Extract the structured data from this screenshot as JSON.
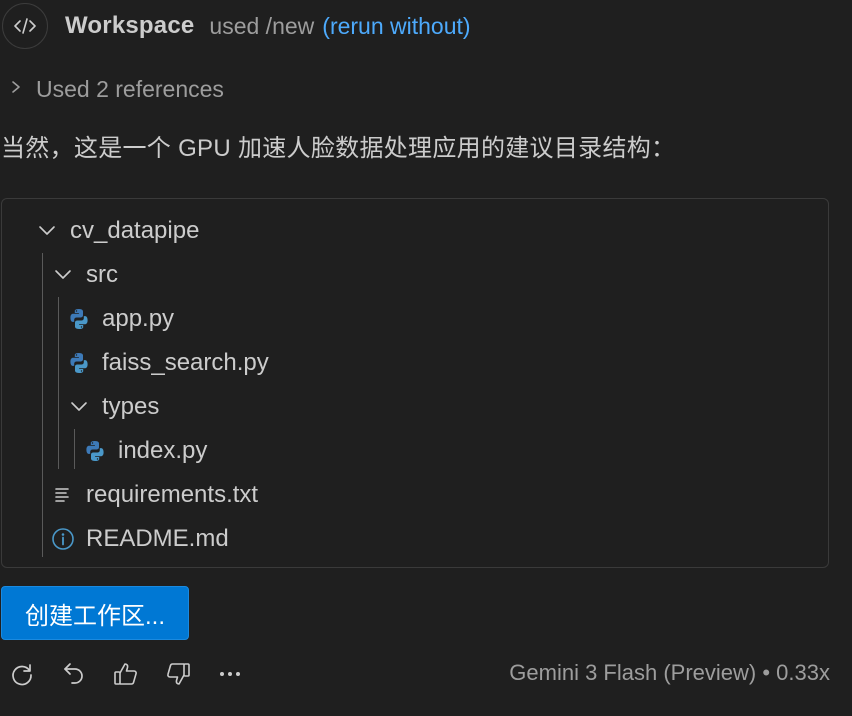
{
  "header": {
    "icon": "code-brackets-icon",
    "title": "Workspace",
    "used_text": "used /new",
    "rerun_link": "(rerun without)"
  },
  "references": {
    "label": "Used 2 references",
    "icon": "chevron-right-icon"
  },
  "intro_text": "当然，这是一个 GPU 加速人脸数据处理应用的建议目录结构：",
  "tree": {
    "items": [
      {
        "name": "cv_datapipe",
        "kind": "folder",
        "expanded": true,
        "depth": 0
      },
      {
        "name": "src",
        "kind": "folder",
        "expanded": true,
        "depth": 1
      },
      {
        "name": "app.py",
        "kind": "python",
        "depth": 2
      },
      {
        "name": "faiss_search.py",
        "kind": "python",
        "depth": 2
      },
      {
        "name": "types",
        "kind": "folder",
        "expanded": true,
        "depth": 2
      },
      {
        "name": "index.py",
        "kind": "python",
        "depth": 3
      },
      {
        "name": "requirements.txt",
        "kind": "text",
        "depth": 1
      },
      {
        "name": "README.md",
        "kind": "info",
        "depth": 1
      }
    ]
  },
  "create_button": {
    "label": "创建工作区..."
  },
  "footer": {
    "icons": [
      "retry-icon",
      "undo-icon",
      "thumbs-up-icon",
      "thumbs-down-icon",
      "more-icon"
    ],
    "model": "Gemini 3 Flash (Preview)",
    "separator": "•",
    "multiplier": "0.33x"
  },
  "colors": {
    "background": "#1f1f1f",
    "link": "#4daafc",
    "button": "#0078d4",
    "python_blue": "#3d7ab8",
    "python_yellow": "#4a98c9"
  }
}
